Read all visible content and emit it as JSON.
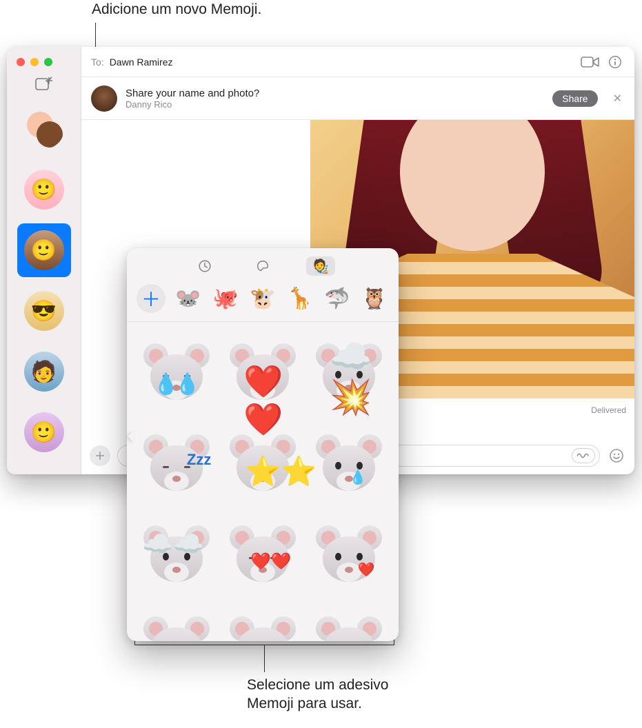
{
  "callouts": {
    "top": "Adicione um novo Memoji.",
    "bottom_line1": "Selecione um adesivo",
    "bottom_line2": "Memoji para usar."
  },
  "header": {
    "to_label": "To:",
    "to_name": "Dawn Ramirez"
  },
  "banner": {
    "title": "Share your name and photo?",
    "subtitle": "Danny Rico",
    "share_label": "Share"
  },
  "status": {
    "delivered": "Delivered"
  },
  "memoji": {
    "tabs": [
      "recents",
      "stickers",
      "memoji"
    ],
    "characters": [
      "add",
      "mouse",
      "octopus",
      "cow",
      "giraffe",
      "shark",
      "owl"
    ],
    "char_glyphs": {
      "mouse": "🐭",
      "octopus": "🐙",
      "cow": "🐮",
      "giraffe": "🦒",
      "shark": "🦈",
      "owl": "🦉"
    },
    "stickers": [
      "mouse-laugh-tears",
      "mouse-heart-eyes",
      "mouse-mind-blown",
      "mouse-sleeping",
      "mouse-star-struck",
      "mouse-sad-tear",
      "mouse-in-clouds",
      "mouse-kiss-hearts",
      "mouse-heart-cheek",
      "mouse-worried",
      "mouse-angry",
      "mouse-sweat"
    ]
  },
  "sidebar": {
    "conversations": [
      "group-1",
      "memoji-pink",
      "memoji-brown",
      "memoji-glasses",
      "person-photo",
      "memoji-purple"
    ],
    "selected_index": 2
  }
}
